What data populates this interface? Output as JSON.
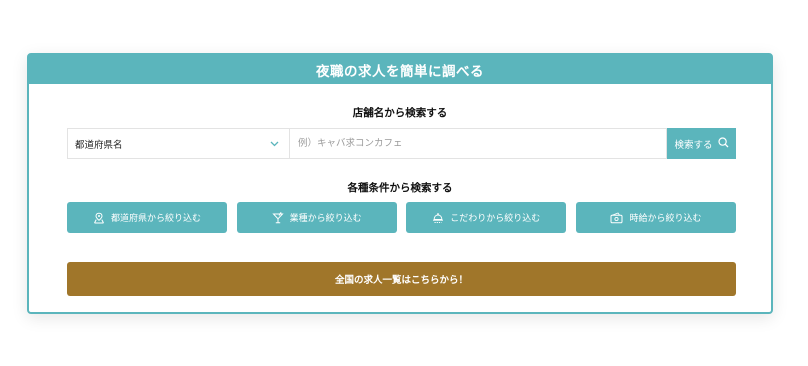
{
  "header": {
    "title": "夜職の求人を簡単に調べる"
  },
  "store_search": {
    "title": "店舗名から検索する",
    "prefecture_select": {
      "value": "都道府県名"
    },
    "keyword_input": {
      "placeholder": "例）キャバ求コンカフェ",
      "value": ""
    },
    "search_button": {
      "label": "検索する"
    }
  },
  "condition_search": {
    "title": "各種条件から検索する",
    "buttons": [
      {
        "label": "都道府県から絞り込む",
        "icon": "map-pin-icon"
      },
      {
        "label": "業種から絞り込む",
        "icon": "cocktail-glass-icon"
      },
      {
        "label": "こだわりから絞り込む",
        "icon": "bell-icon"
      },
      {
        "label": "時給から絞り込む",
        "icon": "wallet-icon"
      }
    ]
  },
  "all_jobs_button": {
    "label": "全国の求人一覧はこちらから！"
  },
  "colors": {
    "accent": "#5bb5bc",
    "all_jobs": "#a0762a",
    "white": "#ffffff"
  }
}
